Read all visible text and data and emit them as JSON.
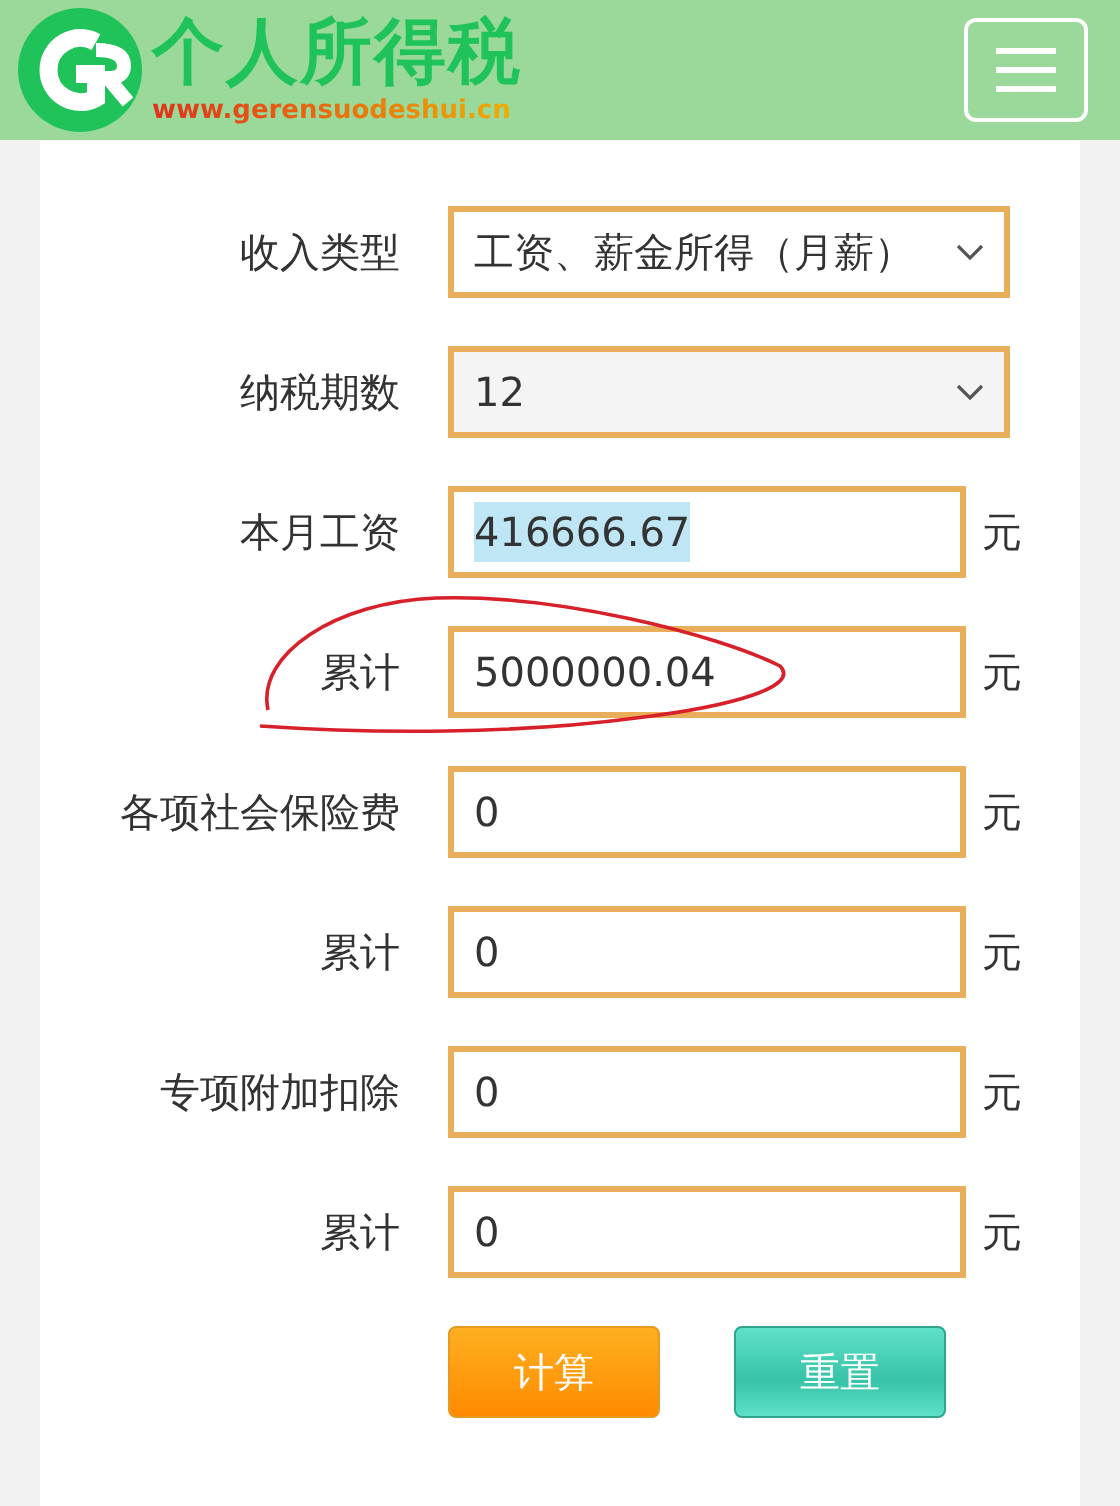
{
  "header": {
    "title": "个人所得税",
    "url": "www.gerensuodeshui.cn"
  },
  "form": {
    "rows": [
      {
        "kind": "select",
        "label": "收入类型",
        "value": "工资、薪金所得（月薪）"
      },
      {
        "kind": "select",
        "label": "纳税期数",
        "value": "12"
      },
      {
        "kind": "input",
        "label": "本月工资",
        "value": "416666.67",
        "unit": "元",
        "text_selected": true,
        "annotated": false
      },
      {
        "kind": "input",
        "label": "累计",
        "value": "5000000.04",
        "unit": "元",
        "text_selected": false,
        "annotated": true
      },
      {
        "kind": "input",
        "label": "各项社会保险费",
        "value": "0",
        "unit": "元",
        "text_selected": false,
        "annotated": false
      },
      {
        "kind": "input",
        "label": "累计",
        "value": "0",
        "unit": "元",
        "text_selected": false,
        "annotated": false
      },
      {
        "kind": "input",
        "label": "专项附加扣除",
        "value": "0",
        "unit": "元",
        "text_selected": false,
        "annotated": false
      },
      {
        "kind": "input",
        "label": "累计",
        "value": "0",
        "unit": "元",
        "text_selected": false,
        "annotated": false
      }
    ],
    "buttons": [
      {
        "kind": "calculate",
        "label": "计算"
      },
      {
        "kind": "reset",
        "label": "重置"
      }
    ]
  }
}
